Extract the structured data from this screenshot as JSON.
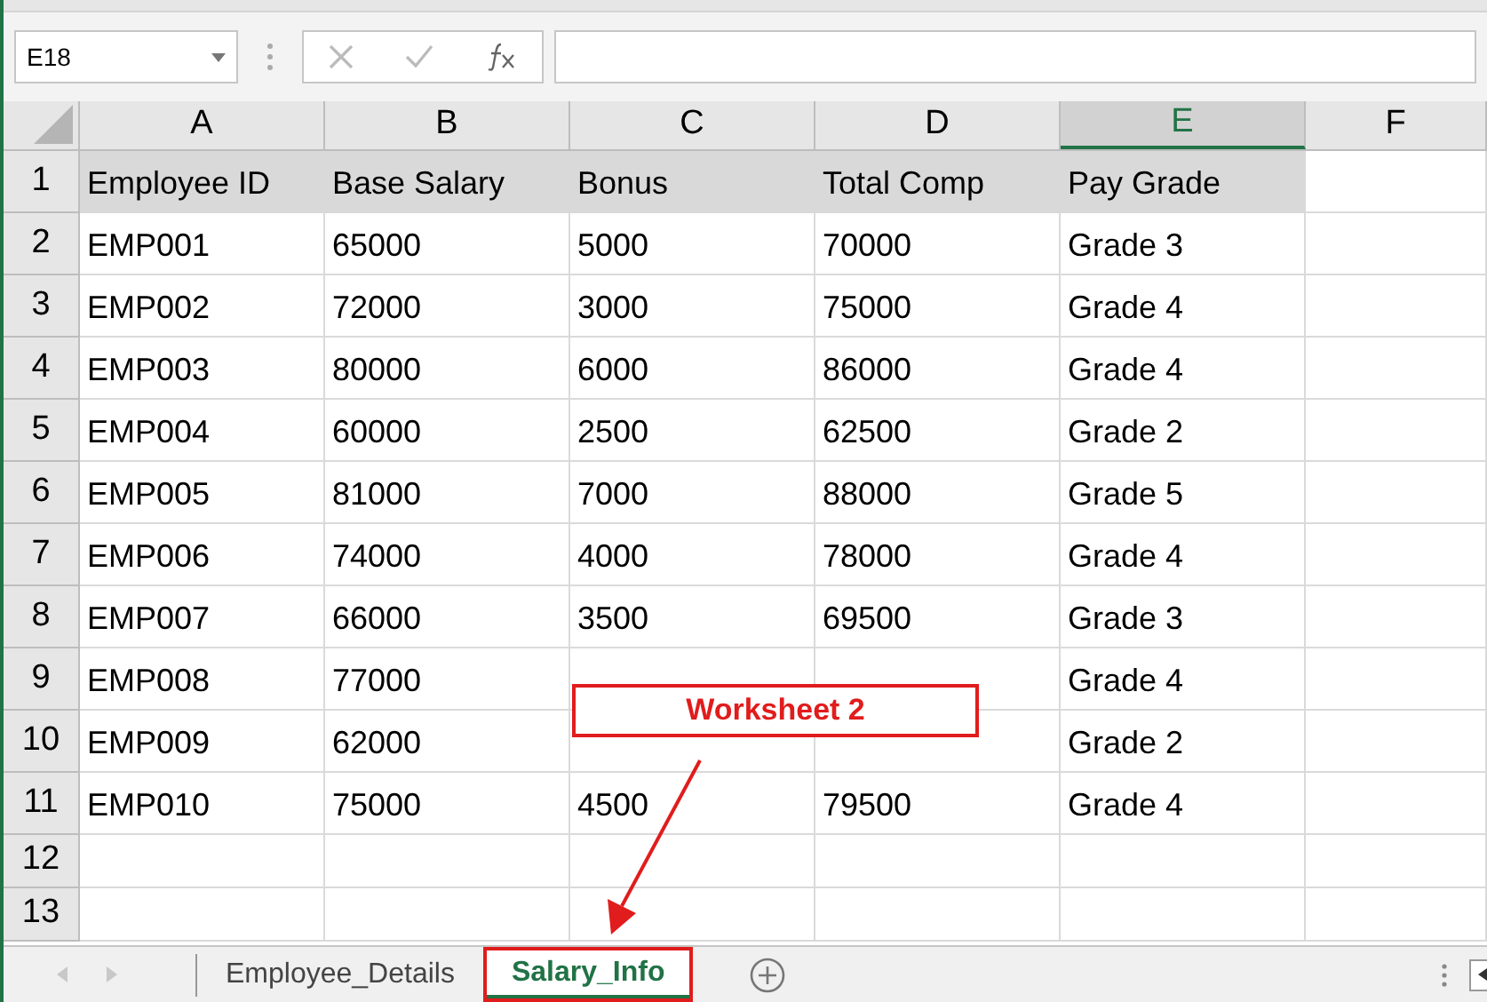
{
  "name_box": {
    "value": "E18"
  },
  "columns": [
    {
      "label": "A",
      "selected": false
    },
    {
      "label": "B",
      "selected": false
    },
    {
      "label": "C",
      "selected": false
    },
    {
      "label": "D",
      "selected": false
    },
    {
      "label": "E",
      "selected": true
    },
    {
      "label": "F",
      "selected": false
    }
  ],
  "rows": [
    {
      "number": "1",
      "kind": "header",
      "cells": [
        "Employee ID",
        "Base Salary",
        "Bonus",
        "Total Comp",
        "Pay Grade"
      ]
    },
    {
      "number": "2",
      "kind": "data",
      "cells": [
        "EMP001",
        "65000",
        "5000",
        "70000",
        "Grade 3"
      ]
    },
    {
      "number": "3",
      "kind": "data",
      "cells": [
        "EMP002",
        "72000",
        "3000",
        "75000",
        "Grade 4"
      ]
    },
    {
      "number": "4",
      "kind": "data",
      "cells": [
        "EMP003",
        "80000",
        "6000",
        "86000",
        "Grade 4"
      ]
    },
    {
      "number": "5",
      "kind": "data",
      "cells": [
        "EMP004",
        "60000",
        "2500",
        "62500",
        "Grade 2"
      ]
    },
    {
      "number": "6",
      "kind": "data",
      "cells": [
        "EMP005",
        "81000",
        "7000",
        "88000",
        "Grade 5"
      ]
    },
    {
      "number": "7",
      "kind": "data",
      "cells": [
        "EMP006",
        "74000",
        "4000",
        "78000",
        "Grade 4"
      ]
    },
    {
      "number": "8",
      "kind": "data",
      "cells": [
        "EMP007",
        "66000",
        "3500",
        "69500",
        "Grade 3"
      ]
    },
    {
      "number": "9",
      "kind": "data",
      "cells": [
        "EMP008",
        "77000",
        null,
        null,
        "Grade 4"
      ]
    },
    {
      "number": "10",
      "kind": "data",
      "cells": [
        "EMP009",
        "62000",
        null,
        null,
        "Grade 2"
      ]
    },
    {
      "number": "11",
      "kind": "data",
      "cells": [
        "EMP010",
        "75000",
        "4500",
        "79500",
        "Grade 4"
      ]
    },
    {
      "number": "12",
      "kind": "empty"
    },
    {
      "number": "13",
      "kind": "empty"
    }
  ],
  "sheet_tabs": [
    {
      "label": "Employee_Details",
      "selected": false,
      "highlighted": false
    },
    {
      "label": "Salary_Info",
      "selected": true,
      "highlighted": true
    }
  ],
  "callout": {
    "text": "Worksheet 2"
  }
}
